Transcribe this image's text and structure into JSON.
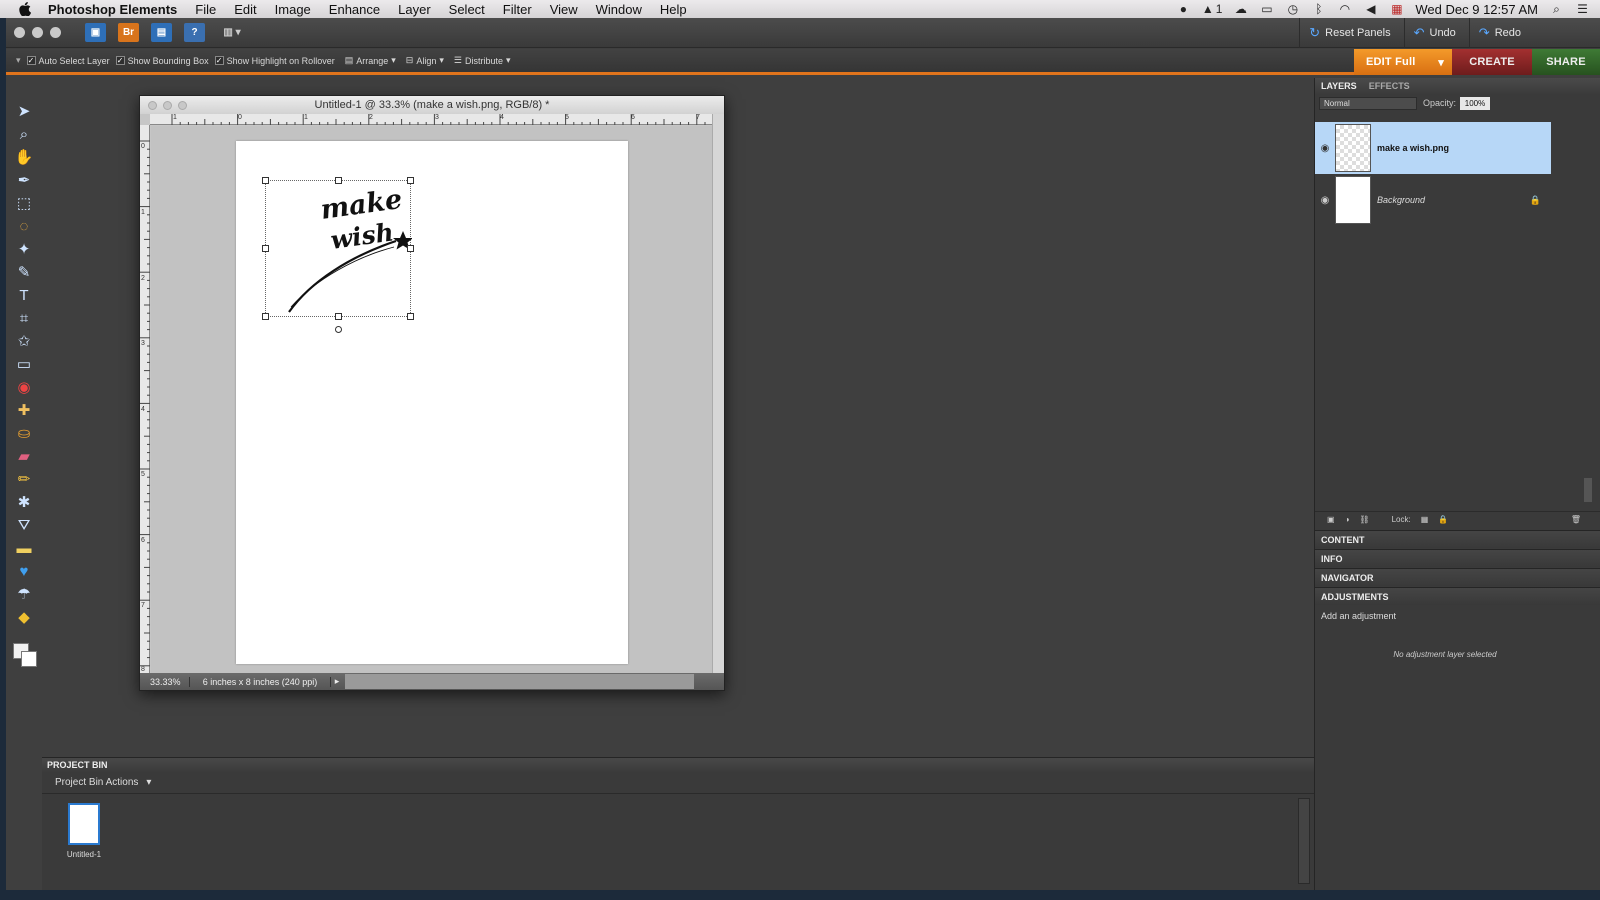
{
  "menubar": {
    "app_name": "Photoshop Elements",
    "items": [
      "File",
      "Edit",
      "Image",
      "Enhance",
      "Layer",
      "Select",
      "Filter",
      "View",
      "Window",
      "Help"
    ],
    "clock": "Wed Dec 9  12:57 AM",
    "notification_count": "1"
  },
  "toolbar": {
    "bridge_label": "Br",
    "help_label": "?",
    "reset_panels": "Reset Panels",
    "undo": "Undo",
    "redo": "Redo"
  },
  "options": {
    "auto_select": "Auto Select Layer",
    "bounding_box": "Show Bounding Box",
    "highlight": "Show Highlight on Rollover",
    "arrange": "Arrange",
    "align": "Align",
    "distribute": "Distribute"
  },
  "modes": {
    "edit": "EDIT Full",
    "create": "CREATE",
    "share": "SHARE"
  },
  "document": {
    "title": "Untitled-1 @ 33.3% (make a wish.png, RGB/8) *",
    "zoom": "33.33%",
    "info": "6 inches x 8 inches (240 ppi)",
    "ruler_top": [
      "1",
      "0",
      "1",
      "2",
      "3",
      "4",
      "5",
      "6",
      "7"
    ],
    "ruler_left": [
      "0",
      "1",
      "2",
      "3",
      "4",
      "5",
      "6",
      "7",
      "8"
    ],
    "art_text_line1": "make a",
    "art_text_line2": "wish"
  },
  "layers_panel": {
    "tab_layers": "LAYERS",
    "tab_effects": "EFFECTS",
    "blend_mode": "Normal",
    "opacity_label": "Opacity:",
    "opacity_value": "100%",
    "lock_label": "Lock:",
    "layers": [
      {
        "name": "make a wish.png",
        "selected": true
      },
      {
        "name": "Background",
        "selected": false
      }
    ]
  },
  "panels": {
    "content": "CONTENT",
    "info": "INFO",
    "navigator": "NAVIGATOR",
    "adjustments": "ADJUSTMENTS",
    "add_adjustment": "Add an adjustment",
    "no_adjustment": "No adjustment layer selected"
  },
  "project_bin": {
    "title": "PROJECT BIN",
    "actions": "Project Bin Actions",
    "item_label": "Untitled-1"
  },
  "colors": {
    "accent_orange": "#e0741c",
    "selection_blue": "#b7d7f7",
    "create_red": "#8a2626",
    "share_green": "#33652a"
  }
}
